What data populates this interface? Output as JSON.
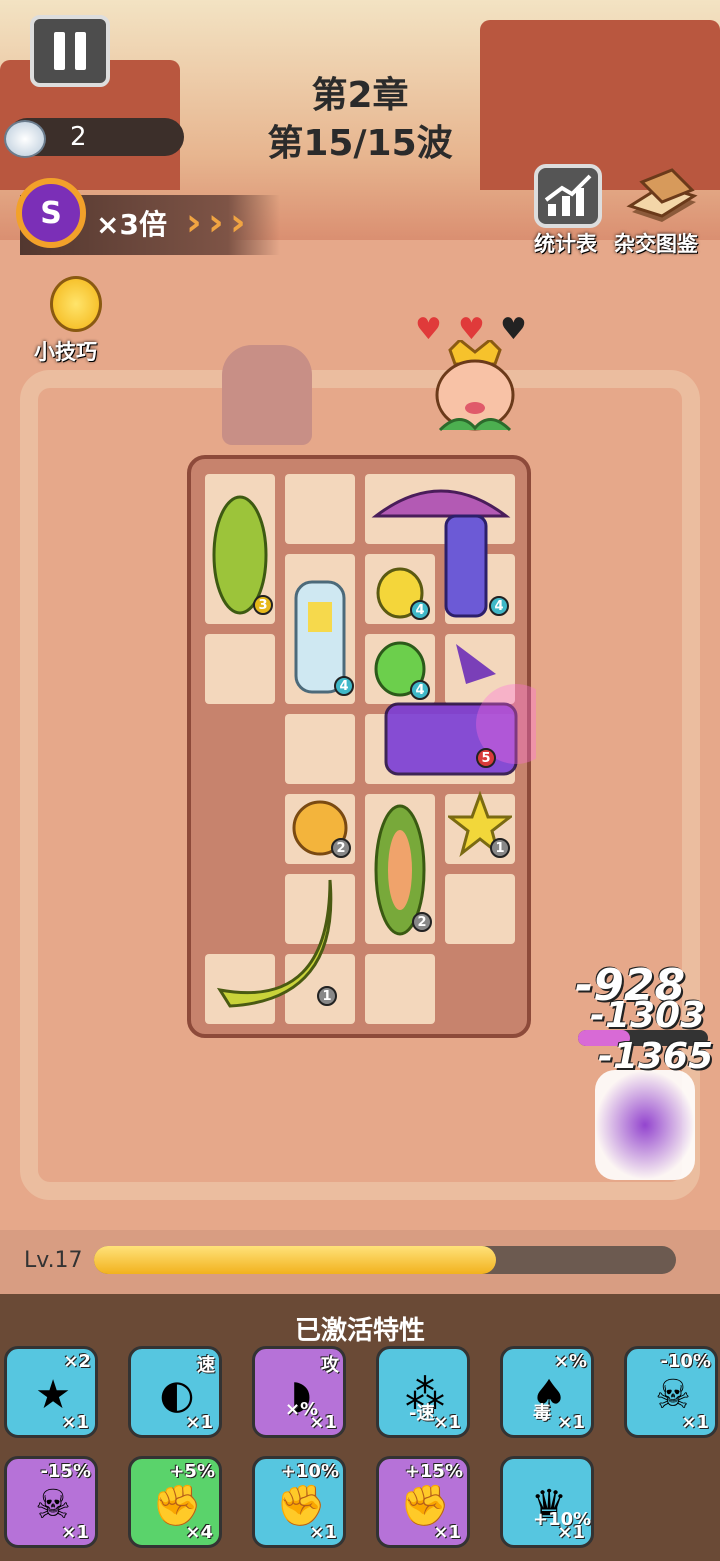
{
  "hud": {
    "chapter": "第2章",
    "wave": "第15/15波",
    "coins": "2",
    "speed_icon_letter": "S",
    "speed_multiplier": "×3倍",
    "stats_label": "统计表",
    "codex_label": "杂交图鉴",
    "tips_label": "小技巧"
  },
  "boss": {
    "hearts_full": 2,
    "hearts_total": 3
  },
  "board_units": [
    {
      "name": "melon",
      "level": "3"
    },
    {
      "name": "banana-robot",
      "level": "4"
    },
    {
      "name": "lemon-bee",
      "level": "4"
    },
    {
      "name": "mushroom-mage",
      "level": "4"
    },
    {
      "name": "green-ghost",
      "level": "4"
    },
    {
      "name": "wizard-banana",
      "level": "5"
    },
    {
      "name": "orange-coin",
      "level": "2"
    },
    {
      "name": "cucumber",
      "level": "2"
    },
    {
      "name": "starfruit",
      "level": "1"
    },
    {
      "name": "banana",
      "level": "1"
    }
  ],
  "damage_numbers": [
    "-928",
    "-1303",
    "-1365"
  ],
  "level": {
    "label": "Lv.17",
    "progress": 0.69
  },
  "traits_title": "已激活特性",
  "traits": [
    {
      "icon": "star-icon",
      "tag": "×2",
      "count": "×1",
      "bg": "#56c6e0"
    },
    {
      "icon": "lemon-icon",
      "tag": "速",
      "count": "×1",
      "bg": "#56c6e0"
    },
    {
      "icon": "melon-slice-icon",
      "tag": "攻",
      "sub": "×%",
      "count": "×1",
      "bg": "#b672d8"
    },
    {
      "icon": "seeds-icon",
      "tag": "",
      "sub": "-速",
      "count": "×1",
      "bg": "#56c6e0"
    },
    {
      "icon": "mushroom-icon",
      "tag": "×%",
      "sub": "毒",
      "count": "×1",
      "bg": "#56c6e0"
    },
    {
      "icon": "skull-icon",
      "tag": "-10%",
      "count": "×1",
      "bg": "#56c6e0"
    },
    {
      "icon": "skull-icon",
      "tag": "-15%",
      "count": "×1",
      "bg": "#b672d8"
    },
    {
      "icon": "fist-icon",
      "tag": "+5%",
      "count": "×4",
      "bg": "#5ad36b"
    },
    {
      "icon": "fist-icon",
      "tag": "+10%",
      "count": "×1",
      "bg": "#56c6e0"
    },
    {
      "icon": "fist-icon",
      "tag": "+15%",
      "count": "×1",
      "bg": "#b672d8"
    },
    {
      "icon": "princess-icon",
      "tag": "",
      "sub": "+10%",
      "count": "×1",
      "bg": "#56c6e0"
    }
  ]
}
